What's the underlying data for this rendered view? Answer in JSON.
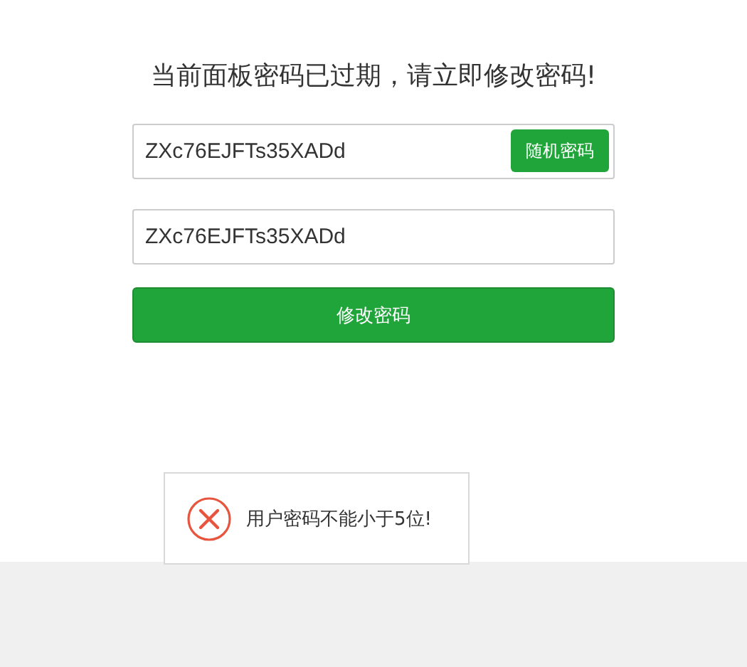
{
  "title": "当前面板密码已过期，请立即修改密码!",
  "password_field": {
    "value": "ZXc76EJFTs35XADd",
    "button": "随机密码"
  },
  "confirm_field": {
    "value": "ZXc76EJFTs35XADd"
  },
  "submit_button": "修改密码",
  "toast": {
    "kind": "error",
    "message": "用户密码不能小于5位!"
  }
}
